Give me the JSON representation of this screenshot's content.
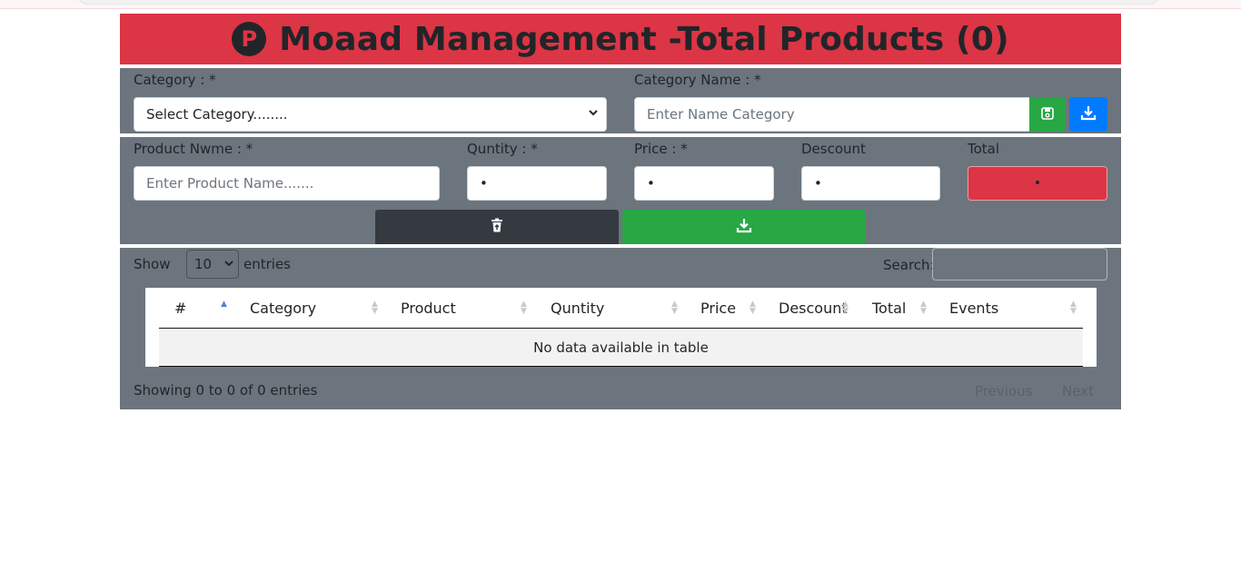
{
  "header": {
    "logo_letter": "P",
    "title": "Moaad Management -Total Products (0)"
  },
  "category_form": {
    "category_label": "Category : *",
    "category_select": "Select Category........",
    "category_name_label": "Category Name : *",
    "category_name_placeholder": "Enter Name Category"
  },
  "product_form": {
    "product_name_label": "Product Nwme : *",
    "product_name_placeholder": "Enter Product Name.......",
    "quantity_label": "Quntity : *",
    "quantity_value": "•",
    "price_label": "Price : *",
    "price_value": "•",
    "discount_label": "Descount",
    "discount_value": "•",
    "total_label": "Total",
    "total_value": "•"
  },
  "table": {
    "show_label": "Show",
    "entries_value": "10",
    "entries_label": "entries",
    "search_label": "Search:",
    "columns": [
      "#",
      "Category",
      "Product",
      "Quntity",
      "Price",
      "Descount",
      "Total",
      "Events"
    ],
    "empty_message": "No data available in table",
    "info": "Showing 0 to 0 of 0 entries",
    "previous": "Previous",
    "next": "Next"
  },
  "colors": {
    "header": "#dc3545",
    "panel": "#6c757d",
    "save": "#28a745",
    "download": "#007bff",
    "delete": "#343a40"
  },
  "icons": {
    "logo": "p-circle-icon",
    "save_category": "floppy-disk-icon",
    "download_category": "download-icon",
    "delete_all": "trash-icon",
    "add_product": "download-icon"
  }
}
